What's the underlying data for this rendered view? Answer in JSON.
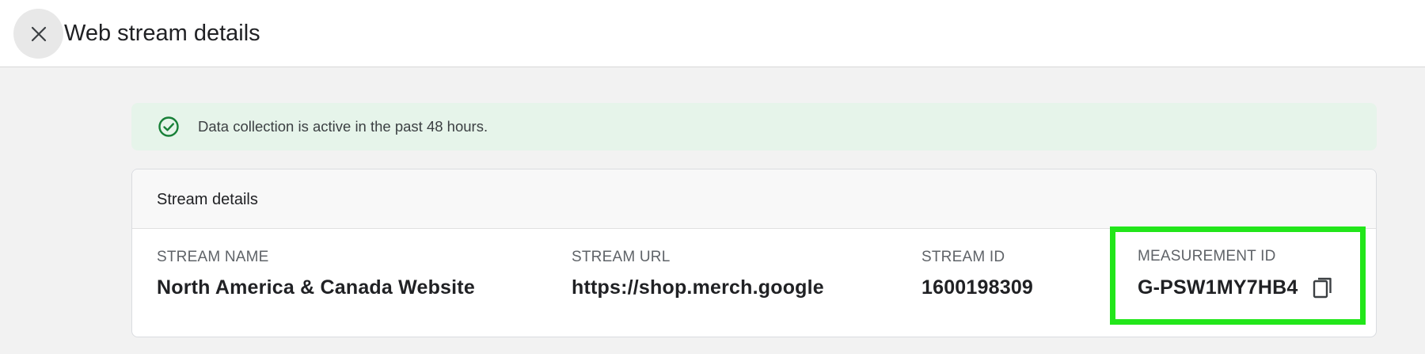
{
  "header": {
    "title": "Web stream details",
    "close_icon": "close-icon"
  },
  "banner": {
    "icon": "check-circle-icon",
    "text": "Data collection is active in the past 48 hours.",
    "color": "#188038",
    "background": "#e6f4ea"
  },
  "stream_details": {
    "title": "Stream details",
    "fields": [
      {
        "label": "STREAM NAME",
        "value": "North America & Canada Website"
      },
      {
        "label": "STREAM URL",
        "value": "https://shop.merch.google"
      },
      {
        "label": "STREAM ID",
        "value": "1600198309"
      },
      {
        "label": "MEASUREMENT ID",
        "value": "G-PSW1MY7HB4",
        "action_icon": "copy-icon"
      }
    ]
  },
  "highlight_color": "#22e61a"
}
